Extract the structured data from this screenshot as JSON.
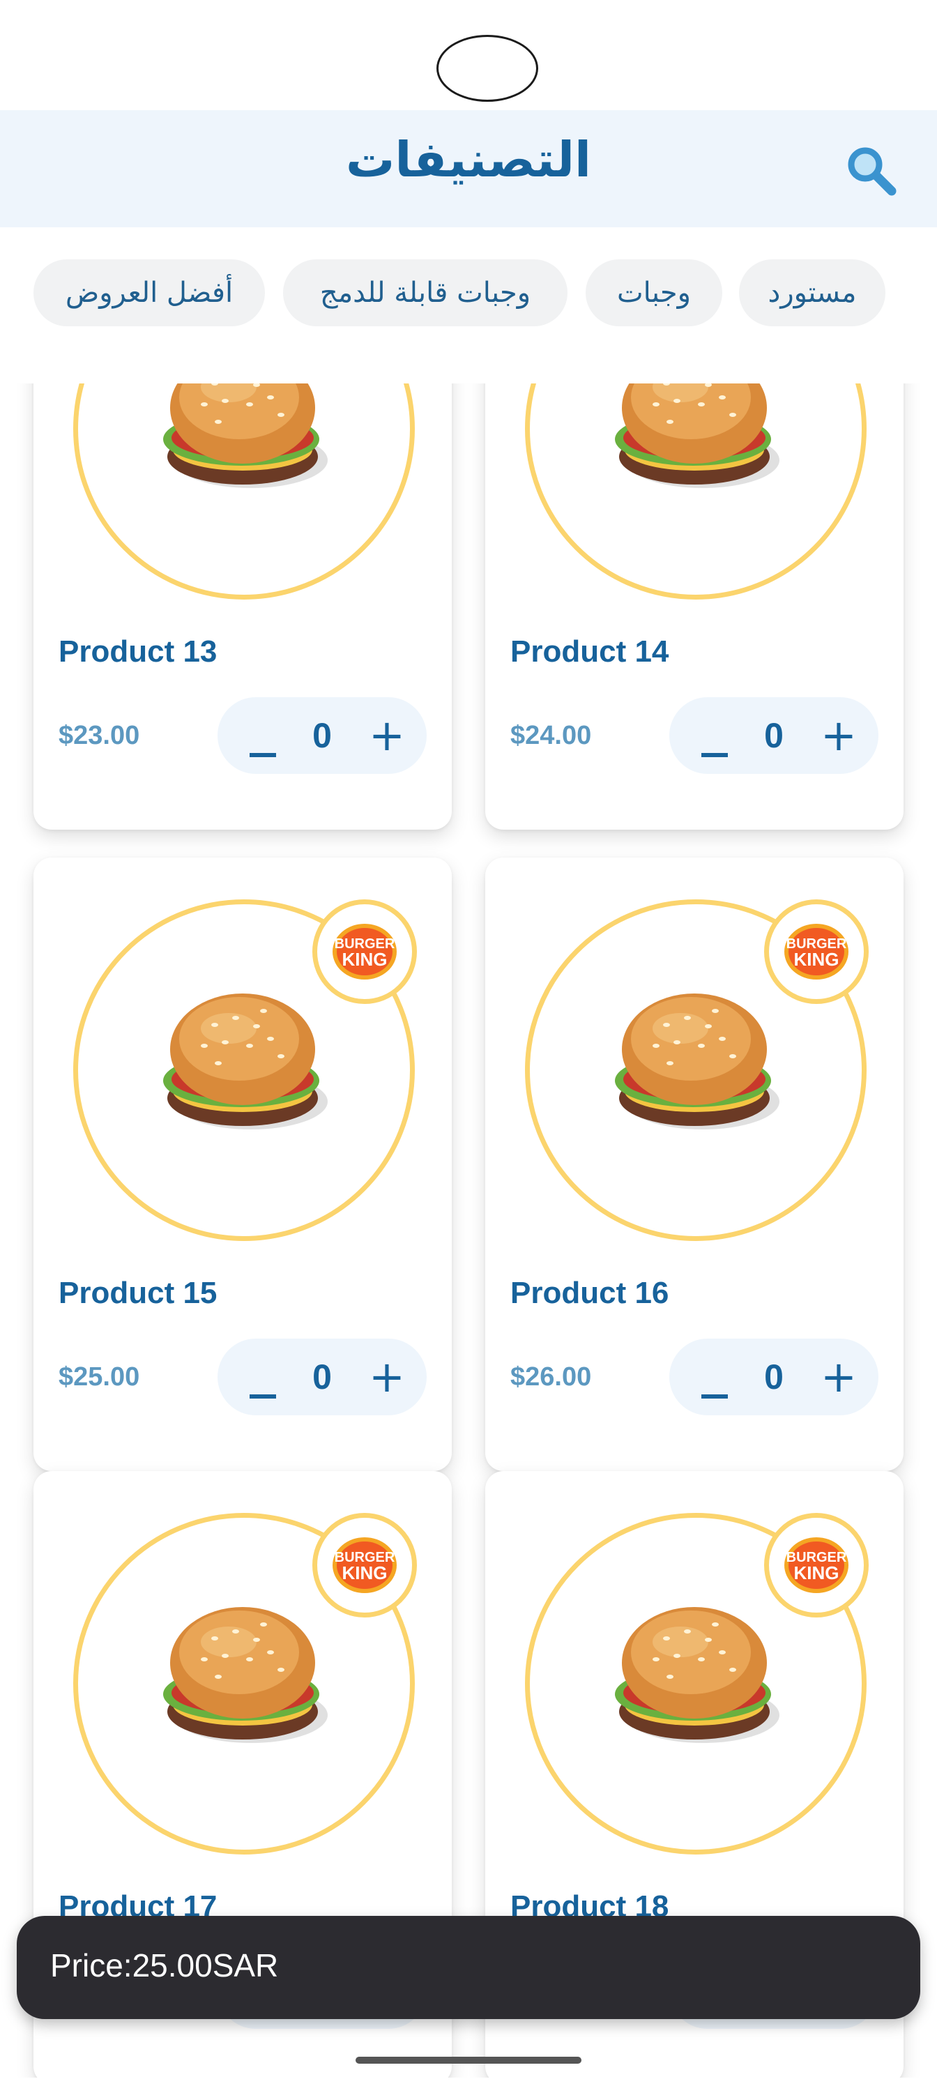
{
  "header": {
    "title": "التصنيفات",
    "search_icon": "search-icon"
  },
  "categories": [
    {
      "label": "مستورد"
    },
    {
      "label": "وجبات"
    },
    {
      "label": "وجبات قابلة للدمج"
    },
    {
      "label": "أفضل العروض"
    }
  ],
  "products": [
    {
      "name": "Product 13",
      "price": "$23.00",
      "qty": "0",
      "badge": false
    },
    {
      "name": "Product 14",
      "price": "$24.00",
      "qty": "0",
      "badge": false
    },
    {
      "name": "Product 15",
      "price": "$25.00",
      "qty": "0",
      "badge": true
    },
    {
      "name": "Product 16",
      "price": "$26.00",
      "qty": "0",
      "badge": true
    },
    {
      "name": "Product 17",
      "price": "",
      "qty": "",
      "badge": true
    },
    {
      "name": "Product 18",
      "price": "",
      "qty": "",
      "badge": true
    }
  ],
  "stepper": {
    "minus": "_",
    "plus": "+"
  },
  "brand_logo": {
    "line1": "BURGER",
    "line2": "KING"
  },
  "snackbar": {
    "text": "Price:25.00SAR"
  },
  "colors": {
    "primary": "#17629b",
    "header_bg": "#eef5fc",
    "ring": "#fbd46d",
    "chip_bg": "#f1f2f3",
    "snackbar_bg": "#2c2b30"
  }
}
